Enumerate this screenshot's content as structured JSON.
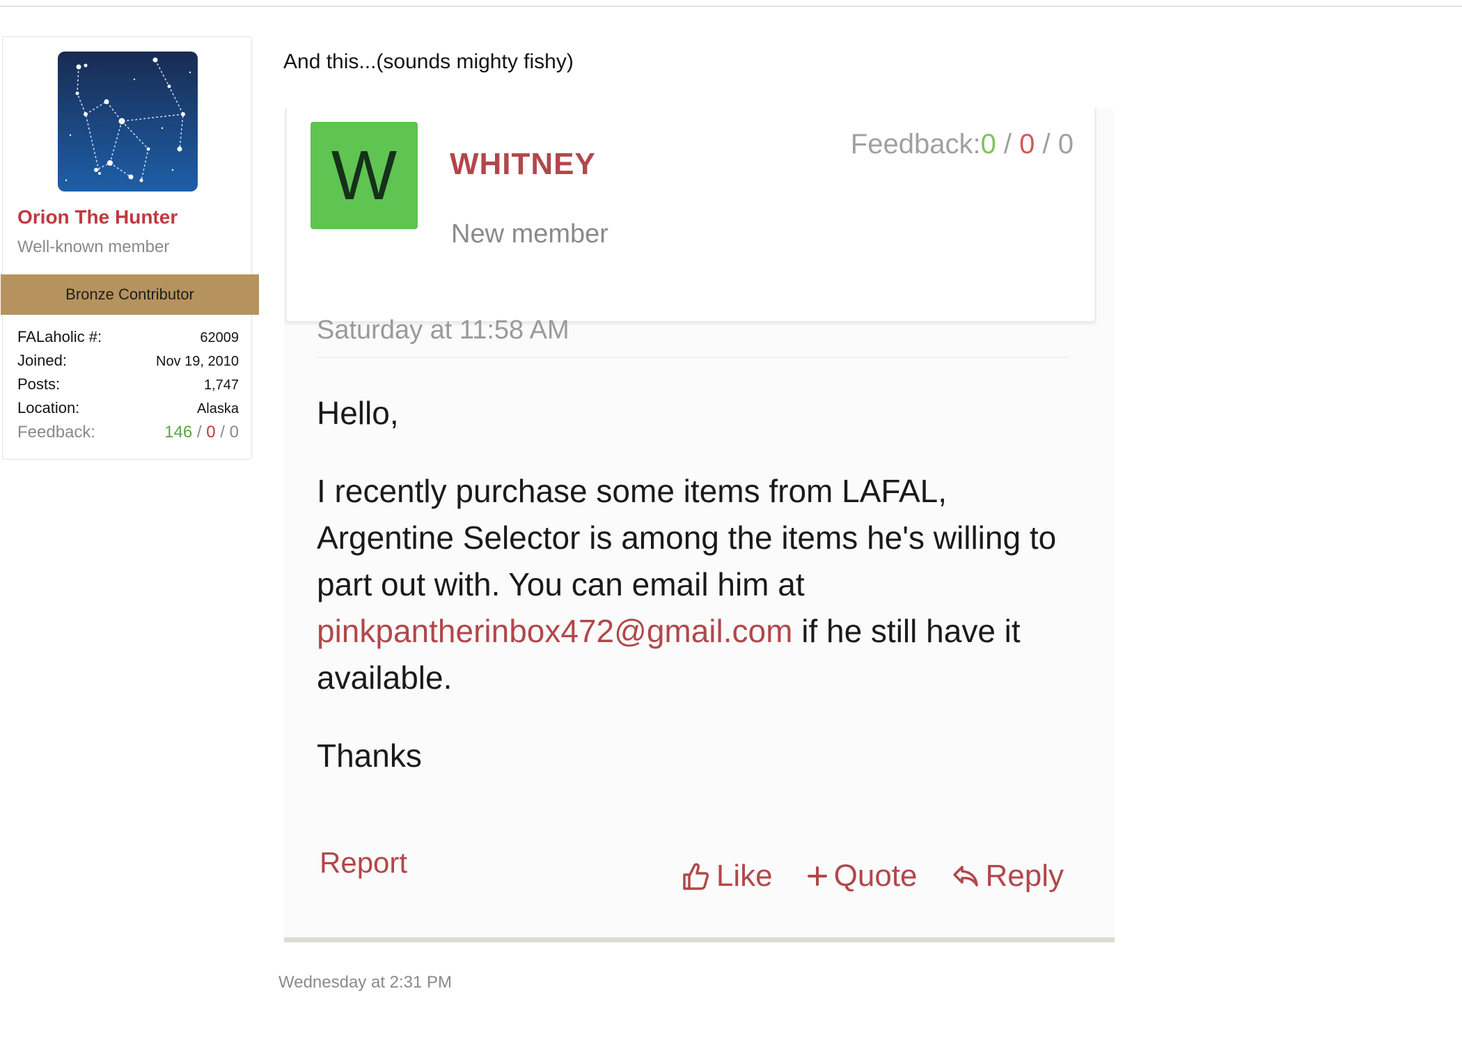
{
  "user": {
    "name": "Orion The Hunter",
    "title": "Well-known member",
    "banner": "Bronze Contributor",
    "stats": [
      {
        "label": "FALaholic #:",
        "value": "62009"
      },
      {
        "label": "Joined:",
        "value": "Nov 19, 2010"
      },
      {
        "label": "Posts:",
        "value": "1,747"
      },
      {
        "label": "Location:",
        "value": "Alaska"
      }
    ],
    "feedback": {
      "label": "Feedback:",
      "positive": "146",
      "negative": "0",
      "neutral": "0",
      "separator": "/"
    },
    "avatar_icon": "constellation-avatar"
  },
  "post": {
    "text": "And this...(sounds mighty fishy)",
    "date": "Wednesday at 2:31 PM"
  },
  "quoted_screenshot": {
    "avatar_letter": "W",
    "name": "WHITNEY",
    "title": "New member",
    "feedback": {
      "label": "Feedback:",
      "positive": "0",
      "negative": "0",
      "neutral": "0",
      "separator": " / "
    },
    "date": "Saturday at 11:58 AM",
    "body": {
      "greeting": "Hello,",
      "message_before_email": "I recently purchase some items from LAFAL, Argentine Selector is among the items he's willing to part out with. You can email him at ",
      "email": "pinkpantherinbox472@gmail.com",
      "message_after_email": " if he still have it available.",
      "signoff": "Thanks"
    },
    "actions": {
      "report": "Report",
      "like": "Like",
      "quote": "Quote",
      "reply": "Reply"
    }
  },
  "colors": {
    "accent": "#c0393e",
    "banner": "#b6935e",
    "positive": "#5aa843",
    "avatar_green": "#5fc452"
  }
}
